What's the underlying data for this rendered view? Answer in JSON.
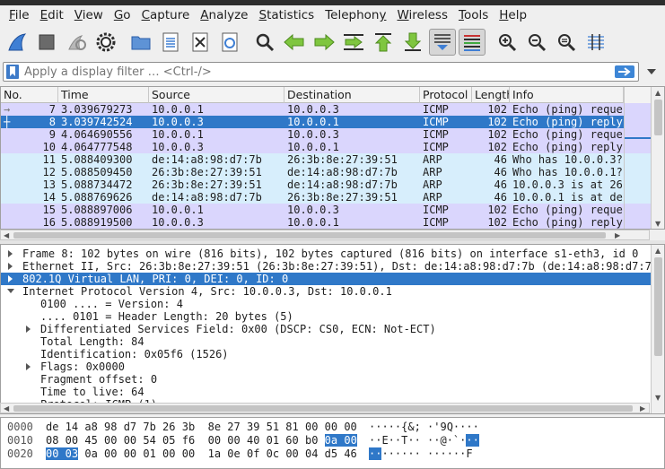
{
  "menubar": [
    {
      "label": "File",
      "u": "F"
    },
    {
      "label": "Edit",
      "u": "E"
    },
    {
      "label": "View",
      "u": "V"
    },
    {
      "label": "Go",
      "u": "G"
    },
    {
      "label": "Capture",
      "u": "C"
    },
    {
      "label": "Analyze",
      "u": "A"
    },
    {
      "label": "Statistics",
      "u": "S"
    },
    {
      "label": "Telephony",
      "u": "y"
    },
    {
      "label": "Wireless",
      "u": "W"
    },
    {
      "label": "Tools",
      "u": "T"
    },
    {
      "label": "Help",
      "u": "H"
    }
  ],
  "filter": {
    "placeholder": "Apply a display filter … <Ctrl-/>"
  },
  "packet_list": {
    "columns": [
      "No.",
      "Time",
      "Source",
      "Destination",
      "Protocol",
      "Length",
      "Info"
    ],
    "rows": [
      {
        "no": "7",
        "time": "3.039679273",
        "src": "10.0.0.1",
        "dst": "10.0.0.3",
        "proto": "ICMP",
        "len": "102",
        "info": "Echo (ping) reque",
        "kind": "icmp",
        "mark": "req"
      },
      {
        "no": "8",
        "time": "3.039742524",
        "src": "10.0.0.3",
        "dst": "10.0.0.1",
        "proto": "ICMP",
        "len": "102",
        "info": "Echo (ping) reply",
        "kind": "selected",
        "mark": "rep"
      },
      {
        "no": "9",
        "time": "4.064690556",
        "src": "10.0.0.1",
        "dst": "10.0.0.3",
        "proto": "ICMP",
        "len": "102",
        "info": "Echo (ping) reque",
        "kind": "icmp",
        "mark": ""
      },
      {
        "no": "10",
        "time": "4.064777548",
        "src": "10.0.0.3",
        "dst": "10.0.0.1",
        "proto": "ICMP",
        "len": "102",
        "info": "Echo (ping) reply",
        "kind": "icmp",
        "mark": ""
      },
      {
        "no": "11",
        "time": "5.088409300",
        "src": "de:14:a8:98:d7:7b",
        "dst": "26:3b:8e:27:39:51",
        "proto": "ARP",
        "len": "46",
        "info": "Who has 10.0.0.3?",
        "kind": "arp",
        "mark": ""
      },
      {
        "no": "12",
        "time": "5.088509450",
        "src": "26:3b:8e:27:39:51",
        "dst": "de:14:a8:98:d7:7b",
        "proto": "ARP",
        "len": "46",
        "info": "Who has 10.0.0.1?",
        "kind": "arp",
        "mark": ""
      },
      {
        "no": "13",
        "time": "5.088734472",
        "src": "26:3b:8e:27:39:51",
        "dst": "de:14:a8:98:d7:7b",
        "proto": "ARP",
        "len": "46",
        "info": "10.0.0.3 is at 26",
        "kind": "arp",
        "mark": ""
      },
      {
        "no": "14",
        "time": "5.088769626",
        "src": "de:14:a8:98:d7:7b",
        "dst": "26:3b:8e:27:39:51",
        "proto": "ARP",
        "len": "46",
        "info": "10.0.0.1 is at de",
        "kind": "arp",
        "mark": ""
      },
      {
        "no": "15",
        "time": "5.088897006",
        "src": "10.0.0.1",
        "dst": "10.0.0.3",
        "proto": "ICMP",
        "len": "102",
        "info": "Echo (ping) reque",
        "kind": "icmp",
        "mark": ""
      },
      {
        "no": "16",
        "time": "5.088919500",
        "src": "10.0.0.3",
        "dst": "10.0.0.1",
        "proto": "ICMP",
        "len": "102",
        "info": "Echo (ping) reply",
        "kind": "icmp",
        "mark": ""
      }
    ]
  },
  "details": [
    {
      "indent": 0,
      "tri": "right",
      "text": "Frame 8: 102 bytes on wire (816 bits), 102 bytes captured (816 bits) on interface s1-eth3, id 0",
      "sel": false
    },
    {
      "indent": 0,
      "tri": "right",
      "text": "Ethernet II, Src: 26:3b:8e:27:39:51 (26:3b:8e:27:39:51), Dst: de:14:a8:98:d7:7b (de:14:a8:98:d7:7b",
      "sel": false
    },
    {
      "indent": 0,
      "tri": "right",
      "text": "802.1Q Virtual LAN, PRI: 0, DEI: 0, ID: 0",
      "sel": true
    },
    {
      "indent": 0,
      "tri": "down",
      "text": "Internet Protocol Version 4, Src: 10.0.0.3, Dst: 10.0.0.1",
      "sel": false
    },
    {
      "indent": 1,
      "tri": "",
      "text": "0100 .... = Version: 4",
      "sel": false
    },
    {
      "indent": 1,
      "tri": "",
      "text": ".... 0101 = Header Length: 20 bytes (5)",
      "sel": false
    },
    {
      "indent": 1,
      "tri": "right",
      "text": "Differentiated Services Field: 0x00 (DSCP: CS0, ECN: Not-ECT)",
      "sel": false
    },
    {
      "indent": 1,
      "tri": "",
      "text": "Total Length: 84",
      "sel": false
    },
    {
      "indent": 1,
      "tri": "",
      "text": "Identification: 0x05f6 (1526)",
      "sel": false
    },
    {
      "indent": 1,
      "tri": "right",
      "text": "Flags: 0x0000",
      "sel": false
    },
    {
      "indent": 1,
      "tri": "",
      "text": "Fragment offset: 0",
      "sel": false
    },
    {
      "indent": 1,
      "tri": "",
      "text": "Time to live: 64",
      "sel": false
    },
    {
      "indent": 1,
      "tri": "",
      "text": "Protocol: ICMP (1)",
      "sel": false
    }
  ],
  "bytes": [
    {
      "offset": "0000",
      "hex": [
        [
          "de 14 a8 98 d7 7b 26 3b  8e 27 39 51 81 00 00 00",
          false
        ]
      ],
      "ascii": [
        [
          "·····{&; ·'9Q····",
          false
        ]
      ]
    },
    {
      "offset": "0010",
      "hex": [
        [
          "08 00 45 00 00 54 05 f6  00 00 40 01 60 b0 ",
          false
        ],
        [
          "0a 00",
          true
        ]
      ],
      "ascii": [
        [
          "··E··T·· ··@·`·",
          false
        ],
        [
          "··",
          true
        ]
      ]
    },
    {
      "offset": "0020",
      "hex": [
        [
          "00 03",
          true
        ],
        [
          " 0a 00 00 01 00 00  1a 0e 0f 0c 00 04 d5 46",
          false
        ]
      ],
      "ascii": [
        [
          "··",
          true
        ],
        [
          "······ ······F",
          false
        ]
      ]
    }
  ],
  "colors": {
    "icmp": "#dad6fd",
    "arp": "#d7eefc",
    "selected": "#2f78c8",
    "accent": "#3d86d6"
  }
}
